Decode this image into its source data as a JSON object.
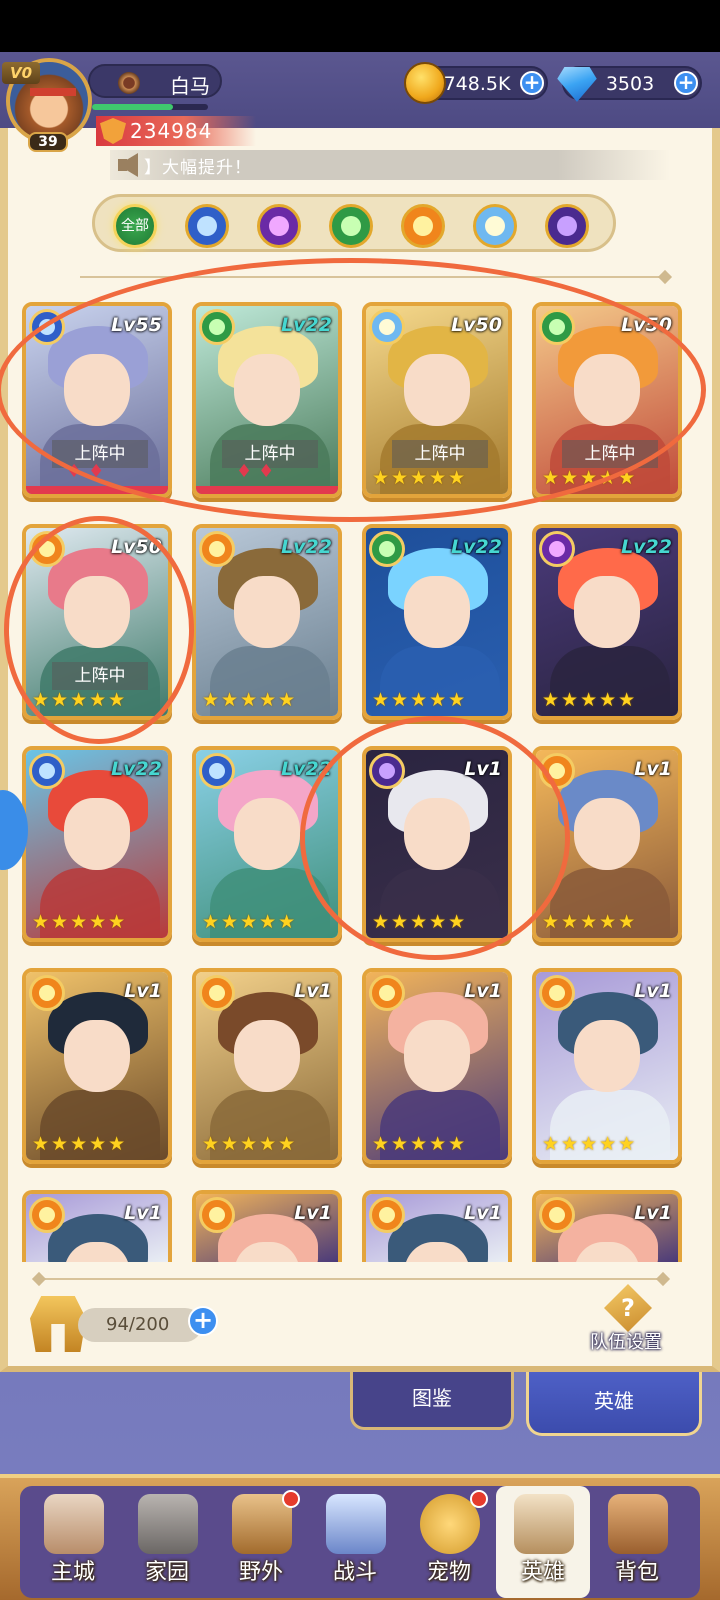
{
  "player": {
    "vip": "V0",
    "name": "白马",
    "level": "39",
    "power": "234984",
    "xp_fraction": 0.7
  },
  "resources": {
    "gold": "748.5K",
    "gems": "3503"
  },
  "announcement": "】大幅提升！",
  "filters": {
    "all_label": "全部",
    "icons": [
      "sun-burst-blue-icon",
      "eye-purple-icon",
      "antler-green-icon",
      "sun-orange-icon",
      "star-burst-light-icon",
      "moon-purple-icon"
    ]
  },
  "heroes": [
    {
      "level": "Lv55",
      "element": "water",
      "deployed": "上阵中",
      "stars": "",
      "badge": "red-diamonds"
    },
    {
      "level": "Lv22",
      "element": "nature",
      "deployed": "上阵中",
      "stars": "",
      "badge": "red-diamonds"
    },
    {
      "level": "Lv50",
      "element": "light",
      "deployed": "上阵中",
      "stars": "★★★★★"
    },
    {
      "level": "Lv50",
      "element": "nature",
      "deployed": "上阵中",
      "stars": "★★★★★"
    },
    {
      "level": "Lv50",
      "element": "fire",
      "deployed": "上阵中",
      "stars": "★★★★★"
    },
    {
      "level": "Lv22",
      "element": "fire",
      "deployed": "",
      "stars": "★★★★★"
    },
    {
      "level": "Lv22",
      "element": "nature",
      "deployed": "",
      "stars": "★★★★★"
    },
    {
      "level": "Lv22",
      "element": "dark",
      "deployed": "",
      "stars": "★★★★★"
    },
    {
      "level": "Lv22",
      "element": "water",
      "deployed": "",
      "stars": "★★★★★"
    },
    {
      "level": "Lv22",
      "element": "water",
      "deployed": "",
      "stars": "★★★★★"
    },
    {
      "level": "Lv1",
      "element": "moon",
      "deployed": "",
      "stars": "★★★★★"
    },
    {
      "level": "Lv1",
      "element": "fire",
      "deployed": "",
      "stars": "★★★★★"
    },
    {
      "level": "Lv1",
      "element": "fire",
      "deployed": "",
      "stars": "★★★★★"
    },
    {
      "level": "Lv1",
      "element": "fire",
      "deployed": "",
      "stars": "★★★★★"
    },
    {
      "level": "Lv1",
      "element": "fire",
      "deployed": "",
      "stars": "★★★★★"
    },
    {
      "level": "Lv1",
      "element": "fire",
      "deployed": "",
      "stars": "★★★★★"
    },
    {
      "level": "Lv1",
      "element": "fire",
      "deployed": "",
      "stars": ""
    },
    {
      "level": "Lv1",
      "element": "fire",
      "deployed": "",
      "stars": ""
    },
    {
      "level": "Lv1",
      "element": "fire",
      "deployed": "",
      "stars": ""
    },
    {
      "level": "Lv1",
      "element": "fire",
      "deployed": "",
      "stars": ""
    }
  ],
  "capacity": "94/200",
  "team_setting": "队伍设置",
  "tabs": {
    "codex": "图鉴",
    "heroes": "英雄"
  },
  "nav": [
    "主城",
    "家园",
    "野外",
    "战斗",
    "宠物",
    "英雄",
    "背包"
  ],
  "colors": {
    "annotation": "#f06a3e",
    "card_border": "#e3a43b",
    "accent_blue": "#3d8ff0"
  }
}
